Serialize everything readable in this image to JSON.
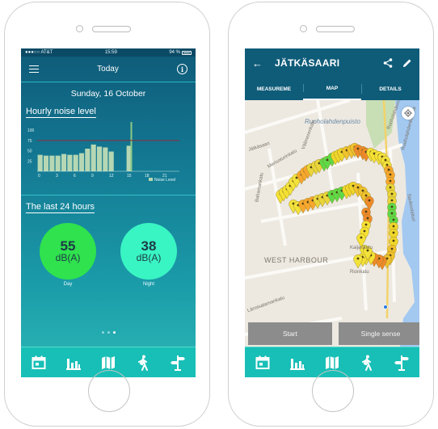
{
  "today_screen": {
    "status": {
      "carrier": "●●●○○ AT&T",
      "time": "15:59",
      "battery": "94 %"
    },
    "title": "Today",
    "date": "Sunday, 16 October",
    "hourly_title": "Hourly noise level",
    "last24_title": "The last 24 hours",
    "day": {
      "value": "55",
      "unit": "dB(A)",
      "label": "Day",
      "color": "#2fe24e"
    },
    "night": {
      "value": "38",
      "unit": "dB(A)",
      "label": "Night",
      "color": "#39f5c3"
    },
    "page_dots": [
      false,
      false,
      true
    ]
  },
  "chart_data": {
    "type": "bar",
    "x": [
      0,
      1,
      2,
      3,
      4,
      5,
      6,
      7,
      8,
      9,
      10,
      11,
      12,
      13,
      14,
      15,
      16,
      17,
      18,
      19,
      20,
      21,
      22,
      23
    ],
    "values": [
      40,
      38,
      38,
      38,
      42,
      40,
      40,
      44,
      55,
      65,
      60,
      58,
      48,
      0,
      0,
      62,
      0,
      0,
      0,
      0,
      0,
      0,
      0,
      0
    ],
    "highlight_bar": {
      "hour": 15,
      "value": 120
    },
    "x_ticks": [
      "0",
      "3",
      "6",
      "9",
      "12",
      "15",
      "18",
      "21"
    ],
    "y_ticks": [
      "25",
      "50",
      "75",
      "100"
    ],
    "ylim": [
      0,
      110
    ],
    "reference_line": 75,
    "legend": "Noise Level",
    "colors": {
      "bar": "#b6d7b3",
      "highlight": "#8bc985",
      "line": "#8a2d3b"
    }
  },
  "map_screen": {
    "title": "JÄTKÄSAARI",
    "tabs": [
      {
        "label": "MEASUREME",
        "active": false
      },
      {
        "label": "MAP",
        "active": true
      },
      {
        "label": "DETAILS",
        "active": false
      }
    ],
    "labels": {
      "ruoholahdenpuisto": "Ruoholahdenpuisto",
      "jatkasaari_area": "Jätkäsaari",
      "merisoturinkatu": "Merisoturinkatu",
      "valtamerenkatu": "Välimerenkatu",
      "bahamankatu": "Bahamankatu",
      "saukonlaituri": "Saukonlaituri",
      "west_harbour": "WEST HARBOUR",
      "rionkatu": "Rionkatu",
      "kaijankatu": "Kaijankatu",
      "lansisatamankatu": "Länsisatamankatu",
      "ruoholahdenranta": "Ruoholahdenranta",
      "ruoholahdenkanava": "Ruoholahdenkanava"
    },
    "start_button": "Start",
    "single_sense_button": "Single sense"
  },
  "tabbar": [
    "calendar-icon",
    "bar-chart-icon",
    "map-icon",
    "walking-icon",
    "signpost-icon"
  ]
}
